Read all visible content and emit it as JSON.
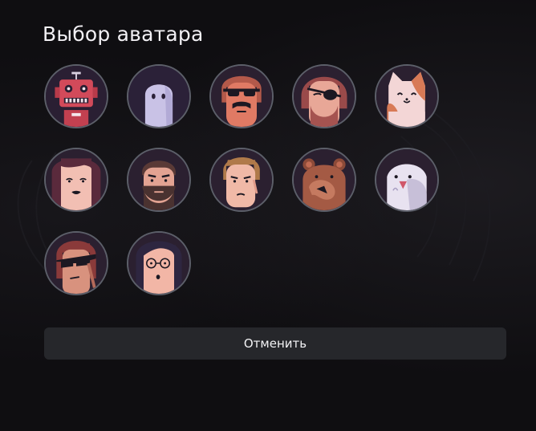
{
  "dialog": {
    "title": "Выбор аватара",
    "cancel_label": "Отменить"
  },
  "avatars": [
    {
      "name": "robot-avatar-icon"
    },
    {
      "name": "ghost-avatar-icon"
    },
    {
      "name": "sunglasses-mustache-man-avatar-icon"
    },
    {
      "name": "eyepatch-bearded-man-avatar-icon"
    },
    {
      "name": "cat-avatar-icon"
    },
    {
      "name": "dark-haired-woman-avatar-icon"
    },
    {
      "name": "bearded-man-avatar-icon"
    },
    {
      "name": "frowning-blond-man-avatar-icon"
    },
    {
      "name": "bear-avatar-icon"
    },
    {
      "name": "bird-avatar-icon"
    },
    {
      "name": "sunglasses-man-avatar-icon"
    },
    {
      "name": "woman-with-glasses-avatar-icon"
    }
  ],
  "colors": {
    "background": "#0f0e11",
    "avatar_border": "#5c5f69",
    "button_bg": "#26272b",
    "skin": "#e7a59a",
    "avatar_bg": "#241d2e"
  }
}
